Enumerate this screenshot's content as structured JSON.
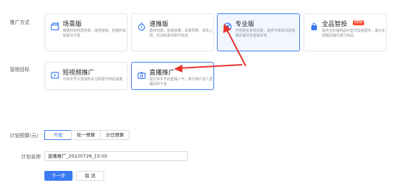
{
  "promotion_method": {
    "label": "推广方式",
    "cards": [
      {
        "id": "scene",
        "title": "场景版",
        "desc": "根据商家经营场景，提供智能、轻量的投放解决方案",
        "icon": "film-clapper-icon"
      },
      {
        "id": "speed",
        "title": "速推版",
        "desc": "极简创建，快速放量；设置预算、成本上限、定向和素材即可投放",
        "icon": "stopwatch-icon"
      },
      {
        "id": "pro",
        "title": "专业版",
        "desc": "开放更多投放设置，提供丰富定向选择，满足差异化营销诉求",
        "icon": "target-gauge-icon"
      },
      {
        "id": "omni",
        "title": "全品智投",
        "badge": "NEW",
        "desc": "提供全店铺商品托管式投放服务，最大化放眼店铺内潜力商品",
        "icon": "shopping-bag-icon"
      }
    ]
  },
  "marketing_target": {
    "label": "营销目标",
    "cards": [
      {
        "id": "short_video",
        "title": "短视频推广",
        "desc": "为快手号引流涨粉关注和提升商品销量",
        "icon": "video-icon"
      },
      {
        "id": "live",
        "title": "直播推广",
        "desc": "提升快手号的直播人气，吸引用户进入直播间并下单",
        "icon": "live-camera-icon"
      }
    ]
  },
  "budget": {
    "label": "计划预算(元)",
    "options": [
      "不限",
      "统一预算",
      "分日预算"
    ],
    "selected": "不限"
  },
  "plan_name": {
    "label": "计划名称",
    "value": "直播推广_20220726_15:05"
  },
  "actions": {
    "next": "下一步",
    "cancel": "取 消"
  },
  "colors": {
    "accent": "#3b7af5",
    "arrow": "#e8322b",
    "badge": "#ff4d2e"
  }
}
